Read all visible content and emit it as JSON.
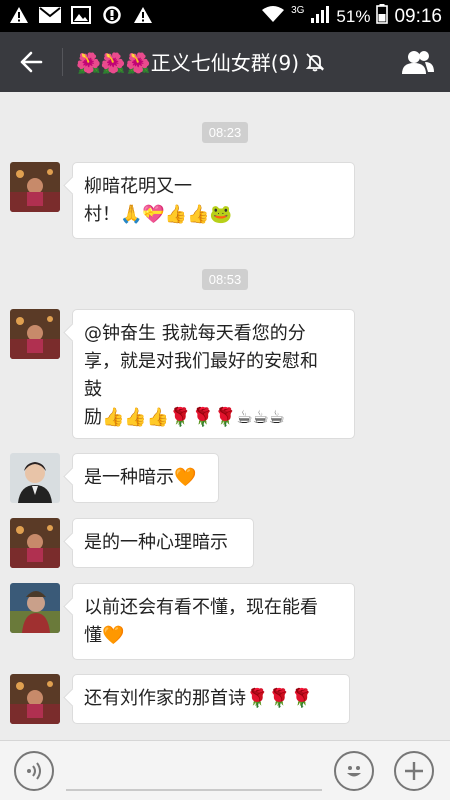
{
  "status_bar": {
    "network": "3G",
    "battery": "51%",
    "time": "09:16"
  },
  "header": {
    "title": "🌺🌺🌺正义七仙女群(9)"
  },
  "messages": [
    {
      "type": "time",
      "text": "08:23"
    },
    {
      "type": "msg",
      "avatar": "avatar-a",
      "lines": [
        "柳暗花明又一",
        "村！🙏💝👍👍🐸"
      ]
    },
    {
      "type": "time",
      "text": "08:53"
    },
    {
      "type": "msg",
      "avatar": "avatar-a",
      "lines": [
        "@钟奋生 我就每天看您的分",
        "享，就是对我们最好的安慰和",
        "鼓",
        "励👍👍👍🌹🌹🌹☕☕☕"
      ]
    },
    {
      "type": "msg",
      "avatar": "avatar-b",
      "lines": [
        "是一种暗示🧡"
      ]
    },
    {
      "type": "msg",
      "avatar": "avatar-a",
      "lines": [
        "是的一种心理暗示"
      ]
    },
    {
      "type": "msg",
      "avatar": "avatar-c",
      "lines": [
        "以前还会有看不懂，现在能看",
        "懂🧡"
      ]
    },
    {
      "type": "msg",
      "avatar": "avatar-a",
      "lines": [
        "还有刘作家的那首诗🌹🌹🌹"
      ]
    }
  ],
  "colors": {
    "titlebar": "#393a3f",
    "chat_bg": "#ececec",
    "bubble": "#ffffff"
  }
}
